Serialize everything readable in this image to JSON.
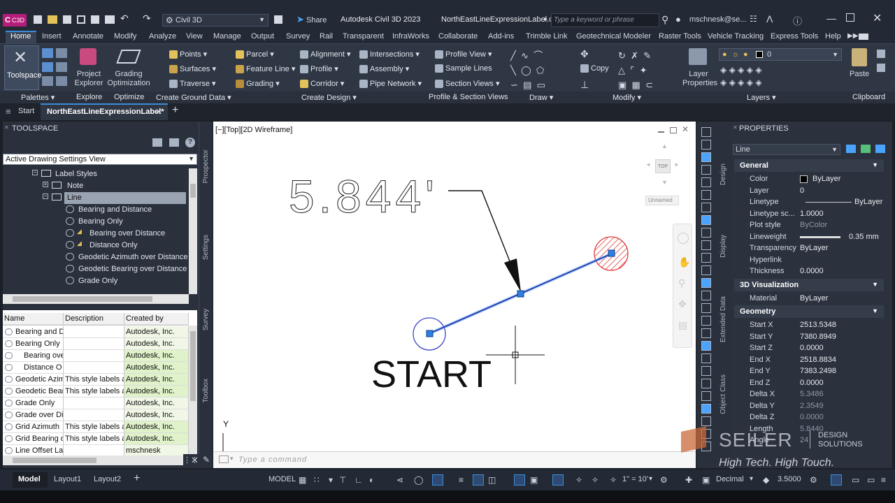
{
  "title_bar": {
    "app_badge": "C",
    "app_badge_sub": "C3D",
    "workspace": "Civil 3D",
    "share_label": "Share",
    "app_title": "Autodesk Civil 3D 2023",
    "filename": "NorthEastLineExpressionLabel.dwg",
    "search_placeholder": "Type a keyword or phrase",
    "user": "mschnesk@se..."
  },
  "menu": [
    "Home",
    "Insert",
    "Annotate",
    "Modify",
    "Analyze",
    "View",
    "Manage",
    "Output",
    "Survey",
    "Rail",
    "Transparent",
    "InfraWorks",
    "Collaborate",
    "Add-ins",
    "Trimble Link",
    "Geotechnical Modeler",
    "Raster Tools",
    "Vehicle Tracking",
    "Express Tools",
    "Help"
  ],
  "ribbon": {
    "toolspace": "Toolspace",
    "project_explorer": "Project\nExplorer",
    "grading_optimization": "Grading\nOptimization",
    "points": "Points",
    "surfaces": "Surfaces",
    "traverse": "Traverse",
    "parcel": "Parcel",
    "feature_line": "Feature Line",
    "grading": "Grading",
    "alignment": "Alignment",
    "profile": "Profile",
    "corridor": "Corridor",
    "intersections": "Intersections",
    "assembly": "Assembly",
    "pipe_network": "Pipe Network",
    "profile_view": "Profile View",
    "sample_lines": "Sample Lines",
    "section_views": "Section Views",
    "copy": "Copy",
    "layer_properties": "Layer\nProperties",
    "layer_value": "0",
    "paste": "Paste",
    "panels": {
      "palettes": "Palettes",
      "explore": "Explore",
      "optimize": "Optimize",
      "create_ground_data": "Create Ground Data",
      "create_design": "Create Design",
      "profile_section_views": "Profile & Section Views",
      "draw": "Draw",
      "modify": "Modify",
      "layers": "Layers",
      "clipboard": "Clipboard"
    }
  },
  "doc_tabs": {
    "start": "Start",
    "active": "NorthEastLineExpressionLabel*"
  },
  "toolspace": {
    "title": "TOOLSPACE",
    "view_select": "Active Drawing Settings View",
    "tree": [
      {
        "label": "Label Styles",
        "indent": 0
      },
      {
        "label": "Note",
        "indent": 1
      },
      {
        "label": "Line",
        "indent": 1
      },
      {
        "label": "Bearing and Distance",
        "indent": 2
      },
      {
        "label": "Bearing Only",
        "indent": 2
      },
      {
        "label": "Bearing over Distance",
        "indent": 3
      },
      {
        "label": "Distance Only",
        "indent": 3
      },
      {
        "label": "Geodetic Azimuth over Distance",
        "indent": 2
      },
      {
        "label": "Geodetic Bearing over Distance",
        "indent": 2
      },
      {
        "label": "Grade Only",
        "indent": 2
      }
    ],
    "table": {
      "headers": [
        "Name",
        "Description",
        "Created by"
      ],
      "rows": [
        [
          "Bearing and D",
          "",
          "Autodesk, Inc."
        ],
        [
          "Bearing Only",
          "",
          "Autodesk, Inc."
        ],
        [
          "Bearing ove",
          "",
          "Autodesk, Inc."
        ],
        [
          "Distance O",
          "",
          "Autodesk, Inc."
        ],
        [
          "Geodetic Azim",
          "This style labels a",
          "Autodesk, Inc."
        ],
        [
          "Geodetic Bear",
          "This style labels a",
          "Autodesk, Inc."
        ],
        [
          "Grade Only",
          "",
          "Autodesk, Inc."
        ],
        [
          "Grade over Dis",
          "",
          "Autodesk, Inc."
        ],
        [
          "Grid Azimuth",
          "This style labels a",
          "Autodesk, Inc."
        ],
        [
          "Grid Bearing o",
          "This style labels a",
          "Autodesk, Inc."
        ],
        [
          "Line Offset Lal",
          "",
          "mschnesk"
        ]
      ]
    },
    "side_tabs": [
      "Prospector",
      "Settings",
      "Survey",
      "Toolbox"
    ]
  },
  "viewport": {
    "label": "[−][Top][2D Wireframe]",
    "distance_label": "5.844'",
    "start_text": "START",
    "viewcube_top": "TOP",
    "ucs_y": "Y",
    "unnamed": "Unnamed",
    "command_placeholder": "Type a command"
  },
  "properties": {
    "title": "PROPERTIES",
    "selection": "Line",
    "general": {
      "header": "General",
      "rows": [
        [
          "Color",
          "ByLayer"
        ],
        [
          "Layer",
          "0"
        ],
        [
          "Linetype",
          "ByLayer"
        ],
        [
          "Linetype sc...",
          "1.0000"
        ],
        [
          "Plot style",
          "ByColor"
        ],
        [
          "Lineweight",
          "0.35 mm"
        ],
        [
          "Transparency",
          "ByLayer"
        ],
        [
          "Hyperlink",
          ""
        ],
        [
          "Thickness",
          "0.0000"
        ]
      ]
    },
    "viz": {
      "header": "3D Visualization",
      "rows": [
        [
          "Material",
          "ByLayer"
        ]
      ]
    },
    "geometry": {
      "header": "Geometry",
      "rows": [
        [
          "Start X",
          "2513.5348"
        ],
        [
          "Start Y",
          "7380.8949"
        ],
        [
          "Start Z",
          "0.0000"
        ],
        [
          "End X",
          "2518.8834"
        ],
        [
          "End Y",
          "7383.2498"
        ],
        [
          "End Z",
          "0.0000"
        ],
        [
          "Delta X",
          "5.3486"
        ],
        [
          "Delta Y",
          "2.3549"
        ],
        [
          "Delta Z",
          "0.0000"
        ],
        [
          "Length",
          "5.8440"
        ],
        [
          "Angle",
          "24"
        ]
      ]
    },
    "side_tabs": [
      "Design",
      "Display",
      "Extended Data",
      "Object Class"
    ]
  },
  "status": {
    "tabs": [
      "Model",
      "Layout1",
      "Layout2"
    ],
    "model": "MODEL",
    "scale": "1\" = 10'",
    "units": "Decimal",
    "elevation": "3.5000"
  },
  "watermark": {
    "brand": "SEILER",
    "sub1": "DESIGN",
    "sub2": "SOLUTIONS",
    "tagline": "High Tech. High Touch."
  },
  "colors": {
    "accent": "#3b8bd8",
    "line": "#1f3fae",
    "grip": "#2f7fe0",
    "hatch": "#e03a3a"
  }
}
